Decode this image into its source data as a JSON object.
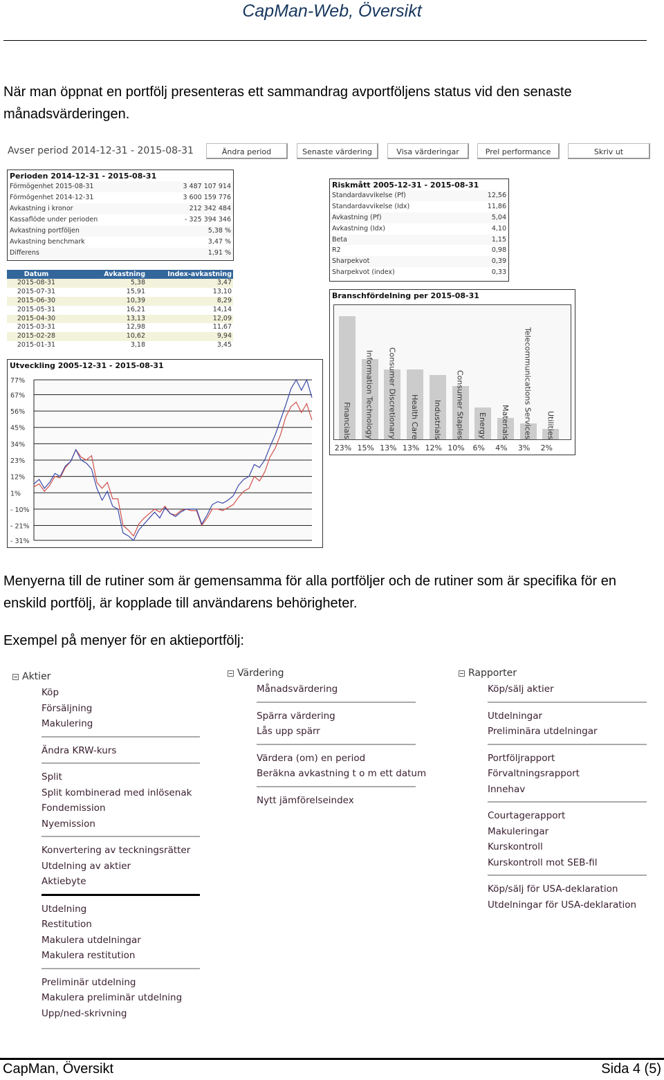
{
  "header": {
    "title": "CapMan-Web, Översikt"
  },
  "intro": "När man öppnat en portfölj presenteras ett sammandrag avportföljens status vid den senaste månadsvärderingen.",
  "ui": {
    "period_label": "Avser period 2014-12-31 - 2015-08-31",
    "buttons": [
      "Ändra period",
      "Senaste värdering",
      "Visa värderingar",
      "Prel performance",
      "Skriv ut"
    ],
    "summary": {
      "title": "Perioden 2014-12-31 - 2015-08-31",
      "rows": [
        {
          "label": "Förmögenhet 2015-08-31",
          "value": "3 487 107 914"
        },
        {
          "label": "Förmögenhet 2014-12-31",
          "value": "3 600 159 776"
        },
        {
          "label": "Avkastning i kronor",
          "value": "212 342 484"
        },
        {
          "label": "Kassaflöde under perioden",
          "value": "- 325 394 346"
        },
        {
          "label": "Avkastning portföljen",
          "value": "5,38 %"
        },
        {
          "label": "Avkastning benchmark",
          "value": "3,47 %"
        },
        {
          "label": "Differens",
          "value": "1,91 %"
        }
      ]
    },
    "returns_table": {
      "headers": [
        "Datum",
        "Avkastning",
        "Index-avkastning"
      ],
      "rows": [
        [
          "2015-08-31",
          "5,38",
          "3,47"
        ],
        [
          "2015-07-31",
          "15,91",
          "13,10"
        ],
        [
          "2015-06-30",
          "10,39",
          "8,29"
        ],
        [
          "2015-05-31",
          "16,21",
          "14,14"
        ],
        [
          "2015-04-30",
          "13,13",
          "12,09"
        ],
        [
          "2015-03-31",
          "12,98",
          "11,67"
        ],
        [
          "2015-02-28",
          "10,62",
          "9,94"
        ],
        [
          "2015-01-31",
          "3,18",
          "3,45"
        ]
      ],
      "header_color": "#33669a"
    },
    "risk": {
      "title": "Riskmått 2005-12-31 - 2015-08-31",
      "rows": [
        {
          "label": "Standardavvikelse (Pf)",
          "value": "12,56"
        },
        {
          "label": "Standardavvikelse (Idx)",
          "value": "11,86"
        },
        {
          "label": "Avkastning (Pf)",
          "value": "5,04"
        },
        {
          "label": "Avkastning (Idx)",
          "value": "4,10"
        },
        {
          "label": "Beta",
          "value": "1,15"
        },
        {
          "label": "R2",
          "value": "0,98"
        },
        {
          "label": "Sharpekvot",
          "value": "0,39"
        },
        {
          "label": "Sharpekvot (index)",
          "value": "0,33"
        }
      ]
    }
  },
  "chart_data": [
    {
      "type": "bar",
      "title": "Branschfördelning per 2015-08-31",
      "categories": [
        "Financials",
        "Information Technology",
        "Consumer Discretionary",
        "Health Care",
        "Industrials",
        "Consumer Staples",
        "Energy",
        "Materials",
        "Telecommunications Services",
        "Utilities"
      ],
      "values": [
        23,
        15,
        13,
        13,
        12,
        10,
        6,
        4,
        3,
        2
      ],
      "value_labels": [
        "23%",
        "15%",
        "13%",
        "13%",
        "12%",
        "10%",
        "6%",
        "4%",
        "3%",
        "2%"
      ],
      "bar_color": "#cccccc"
    },
    {
      "type": "line",
      "title": "Utveckling 2005-12-31 - 2015-08-31",
      "yticks": [
        "77%",
        "67%",
        "56%",
        "45%",
        "34%",
        "23%",
        "12%",
        "1%",
        "- 10%",
        "- 21%",
        "- 31%"
      ],
      "ytick_values": [
        77,
        67,
        56,
        45,
        34,
        23,
        12,
        1,
        -10,
        -21,
        -31
      ],
      "ylim": [
        -31,
        77
      ],
      "grid": true,
      "series": [
        {
          "color": "#3b4aa8",
          "values": [
            7,
            10,
            4,
            8,
            14,
            12,
            19,
            22,
            30,
            23,
            21,
            17,
            4,
            -4,
            2,
            -8,
            -10,
            -26,
            -28,
            -31,
            -24,
            -20,
            -16,
            -12,
            -16,
            -9,
            -13,
            -15,
            -12,
            -10,
            -10,
            -10,
            -20,
            -14,
            -7,
            -5,
            -6,
            -4,
            -1,
            6,
            10,
            12,
            20,
            18,
            23,
            32,
            40,
            50,
            60,
            71,
            77,
            70,
            77,
            65
          ]
        },
        {
          "color": "#d0504a",
          "values": [
            5,
            7,
            2,
            6,
            12,
            11,
            18,
            22,
            30,
            25,
            23,
            26,
            8,
            4,
            8,
            -3,
            -3,
            -21,
            -24,
            -28,
            -20,
            -16,
            -13,
            -10,
            -12,
            -8,
            -13,
            -14,
            -11,
            -10,
            -11,
            -11,
            -21,
            -16,
            -10,
            -10,
            -11,
            -9,
            -7,
            -2,
            2,
            4,
            12,
            9,
            15,
            25,
            31,
            40,
            52,
            59,
            62,
            55,
            61,
            50
          ]
        }
      ]
    }
  ],
  "para2": "Menyerna till de rutiner som är gemensamma för alla portföljer och de rutiner som är specifika för en enskild portfölj, är kopplade till användarens behörigheter.",
  "para3": "Exempel på menyer för en aktieportfölj:",
  "menus": [
    {
      "title": "Aktier",
      "groups": [
        [
          "Köp",
          "Försäljning",
          "Makulering"
        ],
        [
          "Ändra KRW-kurs"
        ],
        [
          "Split",
          "Split kombinerad med inlösenak",
          "Fondemission",
          "Nyemission"
        ],
        [
          "Konvertering av teckningsrätter",
          "Utdelning av aktier",
          "Aktiebyte"
        ],
        [
          "Utdelning",
          "Restitution",
          "Makulera utdelningar",
          "Makulera restitution"
        ],
        [
          "Preliminär utdelning",
          "Makulera preliminär utdelning",
          "Upp/ned-skrivning"
        ]
      ]
    },
    {
      "title": "Värdering",
      "groups": [
        [
          "Månadsvärdering"
        ],
        [
          "Spärra värdering",
          "Lås upp spärr"
        ],
        [
          "Värdera (om) en period",
          "Beräkna avkastning t o m ett datum"
        ],
        [
          "Nytt jämförelseindex"
        ]
      ]
    },
    {
      "title": "Rapporter",
      "groups": [
        [
          "Köp/sälj aktier"
        ],
        [
          "Utdelningar",
          "Preliminära utdelningar"
        ],
        [
          "Portföljrapport",
          "Förvaltningsrapport",
          "Innehav"
        ],
        [
          "Courtagerapport",
          "Makuleringar",
          "Kurskontroll",
          "Kurskontroll mot SEB-fil"
        ],
        [
          "Köp/sälj för USA-deklaration",
          "Utdelningar för USA-deklaration"
        ]
      ]
    }
  ],
  "footer": {
    "left": "CapMan, Översikt",
    "right": "Sida 4 (5)"
  }
}
